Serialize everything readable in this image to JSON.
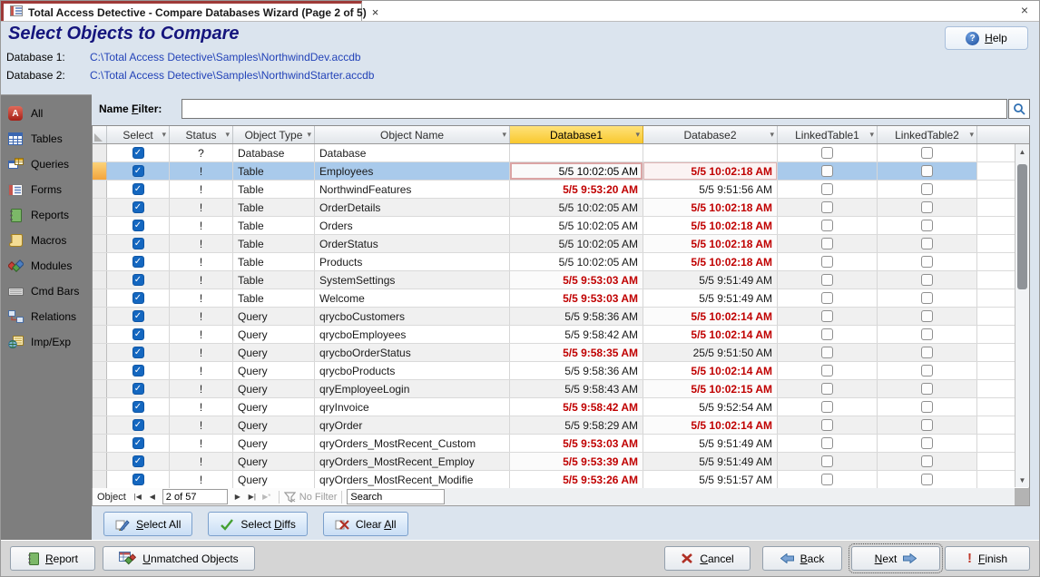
{
  "window": {
    "tab_title": "Total Access Detective - Compare Databases Wizard (Page 2 of 5)",
    "tab_close_glyph": "×",
    "close_glyph": "×"
  },
  "header": {
    "title": "Select Objects to Compare",
    "help": {
      "pre": "",
      "u": "H",
      "post": "elp"
    }
  },
  "databases": [
    {
      "label": "Database 1:",
      "path": "C:\\Total Access Detective\\Samples\\NorthwindDev.accdb"
    },
    {
      "label": "Database 2:",
      "path": "C:\\Total Access Detective\\Samples\\NorthwindStarter.accdb"
    }
  ],
  "sidebar": {
    "items": [
      {
        "id": "all",
        "label": "All"
      },
      {
        "id": "tables",
        "label": "Tables"
      },
      {
        "id": "queries",
        "label": "Queries"
      },
      {
        "id": "forms",
        "label": "Forms"
      },
      {
        "id": "reports",
        "label": "Reports"
      },
      {
        "id": "macros",
        "label": "Macros"
      },
      {
        "id": "modules",
        "label": "Modules"
      },
      {
        "id": "cmdbars",
        "label": "Cmd Bars"
      },
      {
        "id": "relations",
        "label": "Relations"
      },
      {
        "id": "impexp",
        "label": "Imp/Exp"
      }
    ]
  },
  "filter": {
    "label_pre": "Name ",
    "label_u": "F",
    "label_post": "ilter:",
    "value": ""
  },
  "grid": {
    "columns": [
      {
        "label": "Select"
      },
      {
        "label": "Status"
      },
      {
        "label": "Object Type"
      },
      {
        "label": "Object Name"
      },
      {
        "label": "Database1",
        "highlighted": true
      },
      {
        "label": "Database2"
      },
      {
        "label": "LinkedTable1"
      },
      {
        "label": "LinkedTable2"
      }
    ],
    "rows": [
      {
        "selected": true,
        "status": "?",
        "object_type": "Database",
        "object_name": "Database",
        "database1": "",
        "database1_diff": false,
        "database2": "",
        "database2_diff": false,
        "linked_table1": false,
        "linked_table2": false,
        "current_row": false
      },
      {
        "selected": true,
        "status": "!",
        "object_type": "Table",
        "object_name": "Employees",
        "database1": "5/5 10:02:05 AM",
        "database1_diff": false,
        "database2": "5/5 10:02:18 AM",
        "database2_diff": true,
        "linked_table1": false,
        "linked_table2": false,
        "current_row": true
      },
      {
        "selected": true,
        "status": "!",
        "object_type": "Table",
        "object_name": "NorthwindFeatures",
        "database1": "5/5 9:53:20 AM",
        "database1_diff": true,
        "database2": "5/5 9:51:56 AM",
        "database2_diff": false,
        "linked_table1": false,
        "linked_table2": false,
        "current_row": false
      },
      {
        "selected": true,
        "status": "!",
        "object_type": "Table",
        "object_name": "OrderDetails",
        "database1": "5/5 10:02:05 AM",
        "database1_diff": false,
        "database2": "5/5 10:02:18 AM",
        "database2_diff": true,
        "linked_table1": false,
        "linked_table2": false,
        "current_row": false
      },
      {
        "selected": true,
        "status": "!",
        "object_type": "Table",
        "object_name": "Orders",
        "database1": "5/5 10:02:05 AM",
        "database1_diff": false,
        "database2": "5/5 10:02:18 AM",
        "database2_diff": true,
        "linked_table1": false,
        "linked_table2": false,
        "current_row": false
      },
      {
        "selected": true,
        "status": "!",
        "object_type": "Table",
        "object_name": "OrderStatus",
        "database1": "5/5 10:02:05 AM",
        "database1_diff": false,
        "database2": "5/5 10:02:18 AM",
        "database2_diff": true,
        "linked_table1": false,
        "linked_table2": false,
        "current_row": false
      },
      {
        "selected": true,
        "status": "!",
        "object_type": "Table",
        "object_name": "Products",
        "database1": "5/5 10:02:05 AM",
        "database1_diff": false,
        "database2": "5/5 10:02:18 AM",
        "database2_diff": true,
        "linked_table1": false,
        "linked_table2": false,
        "current_row": false
      },
      {
        "selected": true,
        "status": "!",
        "object_type": "Table",
        "object_name": "SystemSettings",
        "database1": "5/5 9:53:03 AM",
        "database1_diff": true,
        "database2": "5/5 9:51:49 AM",
        "database2_diff": false,
        "linked_table1": false,
        "linked_table2": false,
        "current_row": false
      },
      {
        "selected": true,
        "status": "!",
        "object_type": "Table",
        "object_name": "Welcome",
        "database1": "5/5 9:53:03 AM",
        "database1_diff": true,
        "database2": "5/5 9:51:49 AM",
        "database2_diff": false,
        "linked_table1": false,
        "linked_table2": false,
        "current_row": false
      },
      {
        "selected": true,
        "status": "!",
        "object_type": "Query",
        "object_name": "qrycboCustomers",
        "database1": "5/5 9:58:36 AM",
        "database1_diff": false,
        "database2": "5/5 10:02:14 AM",
        "database2_diff": true,
        "linked_table1": false,
        "linked_table2": false,
        "current_row": false
      },
      {
        "selected": true,
        "status": "!",
        "object_type": "Query",
        "object_name": "qrycboEmployees",
        "database1": "5/5 9:58:42 AM",
        "database1_diff": false,
        "database2": "5/5 10:02:14 AM",
        "database2_diff": true,
        "linked_table1": false,
        "linked_table2": false,
        "current_row": false
      },
      {
        "selected": true,
        "status": "!",
        "object_type": "Query",
        "object_name": "qrycboOrderStatus",
        "database1": "5/5 9:58:35 AM",
        "database1_diff": true,
        "database2": "25/5 9:51:50 AM",
        "database2_diff": false,
        "linked_table1": false,
        "linked_table2": false,
        "current_row": false
      },
      {
        "selected": true,
        "status": "!",
        "object_type": "Query",
        "object_name": "qrycboProducts",
        "database1": "5/5 9:58:36 AM",
        "database1_diff": false,
        "database2": "5/5 10:02:14 AM",
        "database2_diff": true,
        "linked_table1": false,
        "linked_table2": false,
        "current_row": false
      },
      {
        "selected": true,
        "status": "!",
        "object_type": "Query",
        "object_name": "qryEmployeeLogin",
        "database1": "5/5 9:58:43 AM",
        "database1_diff": false,
        "database2": "5/5 10:02:15 AM",
        "database2_diff": true,
        "linked_table1": false,
        "linked_table2": false,
        "current_row": false
      },
      {
        "selected": true,
        "status": "!",
        "object_type": "Query",
        "object_name": "qryInvoice",
        "database1": "5/5 9:58:42 AM",
        "database1_diff": true,
        "database2": "5/5 9:52:54 AM",
        "database2_diff": false,
        "linked_table1": false,
        "linked_table2": false,
        "current_row": false
      },
      {
        "selected": true,
        "status": "!",
        "object_type": "Query",
        "object_name": "qryOrder",
        "database1": "5/5 9:58:29 AM",
        "database1_diff": false,
        "database2": "5/5 10:02:14 AM",
        "database2_diff": true,
        "linked_table1": false,
        "linked_table2": false,
        "current_row": false
      },
      {
        "selected": true,
        "status": "!",
        "object_type": "Query",
        "object_name": "qryOrders_MostRecent_Custom",
        "database1": "5/5 9:53:03 AM",
        "database1_diff": true,
        "database2": "5/5 9:51:49 AM",
        "database2_diff": false,
        "linked_table1": false,
        "linked_table2": false,
        "current_row": false
      },
      {
        "selected": true,
        "status": "!",
        "object_type": "Query",
        "object_name": "qryOrders_MostRecent_Employ",
        "database1": "5/5 9:53:39 AM",
        "database1_diff": true,
        "database2": "5/5 9:51:49 AM",
        "database2_diff": false,
        "linked_table1": false,
        "linked_table2": false,
        "current_row": false
      },
      {
        "selected": true,
        "status": "!",
        "object_type": "Query",
        "object_name": "qryOrders_MostRecent_Modifie",
        "database1": "5/5 9:53:26 AM",
        "database1_diff": true,
        "database2": "5/5 9:51:57 AM",
        "database2_diff": false,
        "linked_table1": false,
        "linked_table2": false,
        "current_row": false
      }
    ]
  },
  "navigator": {
    "label": "Object",
    "first": "◀",
    "prev": "◀",
    "position": "2 of 57",
    "next": "▶",
    "last": "▶",
    "new_record": "▶*",
    "no_filter": "No Filter",
    "search": "Search"
  },
  "actions": {
    "select_all": {
      "pre": "",
      "u": "S",
      "post": "elect All"
    },
    "select_diffs": {
      "pre": "Select ",
      "u": "D",
      "post": "iffs"
    },
    "clear_all": {
      "pre": "Clear ",
      "u": "A",
      "post": "ll"
    }
  },
  "footer": {
    "report": {
      "pre": "",
      "u": "R",
      "post": "eport"
    },
    "unmatched": {
      "pre": "",
      "u": "U",
      "post": "nmatched Objects"
    },
    "cancel": {
      "pre": "",
      "u": "C",
      "post": "ancel"
    },
    "back": {
      "pre": "",
      "u": "B",
      "post": "ack"
    },
    "next": {
      "pre": "",
      "u": "N",
      "post": "ext"
    },
    "finish": {
      "pre": "",
      "u": "F",
      "post": "inish"
    }
  },
  "colors": {
    "diff_red": "#C00000",
    "selected_row_blue": "#A9CAEB",
    "database1_header_yellow": "#F9C82E",
    "checkbox_blue": "#1467C0",
    "title_navy": "#15157D",
    "path_blue": "#2343B8",
    "sidebar_gray": "#7E7E7E"
  }
}
